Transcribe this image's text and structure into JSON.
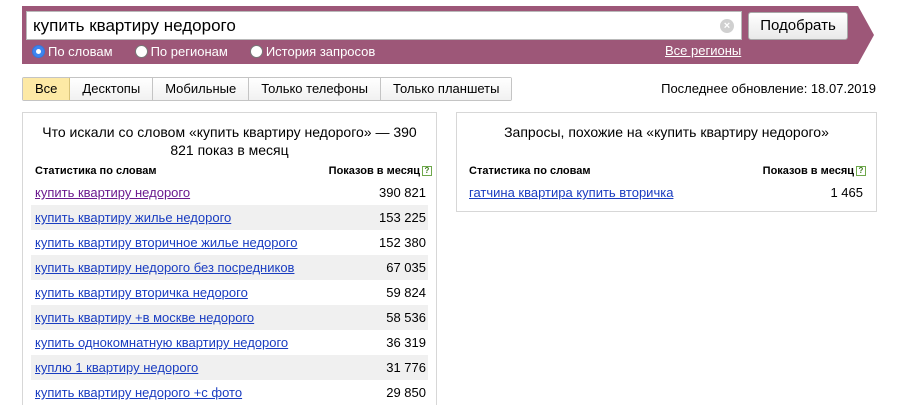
{
  "search": {
    "query": "купить квартиру недорого",
    "submit_label": "Подобрать"
  },
  "modes": [
    {
      "label": "По словам",
      "checked": true
    },
    {
      "label": "По регионам",
      "checked": false
    },
    {
      "label": "История запросов",
      "checked": false
    }
  ],
  "regions_link": "Все регионы",
  "tabs": [
    "Все",
    "Десктопы",
    "Мобильные",
    "Только телефоны",
    "Только планшеты"
  ],
  "active_tab": "Все",
  "last_update": "Последнее обновление: 18.07.2019",
  "left_panel": {
    "title": "Что искали со словом «купить квартиру недорого» — 390 821 показ в месяц",
    "col_phrase": "Статистика по словам",
    "col_count": "Показов в месяц",
    "rows": [
      {
        "phrase": "купить квартиру недорого",
        "count": "390 821"
      },
      {
        "phrase": "купить квартиру жилье недорого",
        "count": "153 225"
      },
      {
        "phrase": "купить квартиру вторичное жилье недорого",
        "count": "152 380"
      },
      {
        "phrase": "купить квартиру недорого без посредников",
        "count": "67 035"
      },
      {
        "phrase": "купить квартиру вторичка недорого",
        "count": "59 824"
      },
      {
        "phrase": "купить квартиру +в москве недорого",
        "count": "58 536"
      },
      {
        "phrase": "купить однокомнатную квартиру недорого",
        "count": "36 319"
      },
      {
        "phrase": "куплю 1 квартиру недорого",
        "count": "31 776"
      },
      {
        "phrase": "купить квартиру недорого +с фото",
        "count": "29 850"
      }
    ]
  },
  "right_panel": {
    "title": "Запросы, похожие на «купить квартиру недорого»",
    "col_phrase": "Статистика по словам",
    "col_count": "Показов в месяц",
    "rows": [
      {
        "phrase": "гатчина квартира купить вторичка",
        "count": "1 465"
      }
    ]
  },
  "colors": {
    "header": "#9d5778",
    "link": "#1a3dc1",
    "active_tab": "#fde9a5"
  }
}
